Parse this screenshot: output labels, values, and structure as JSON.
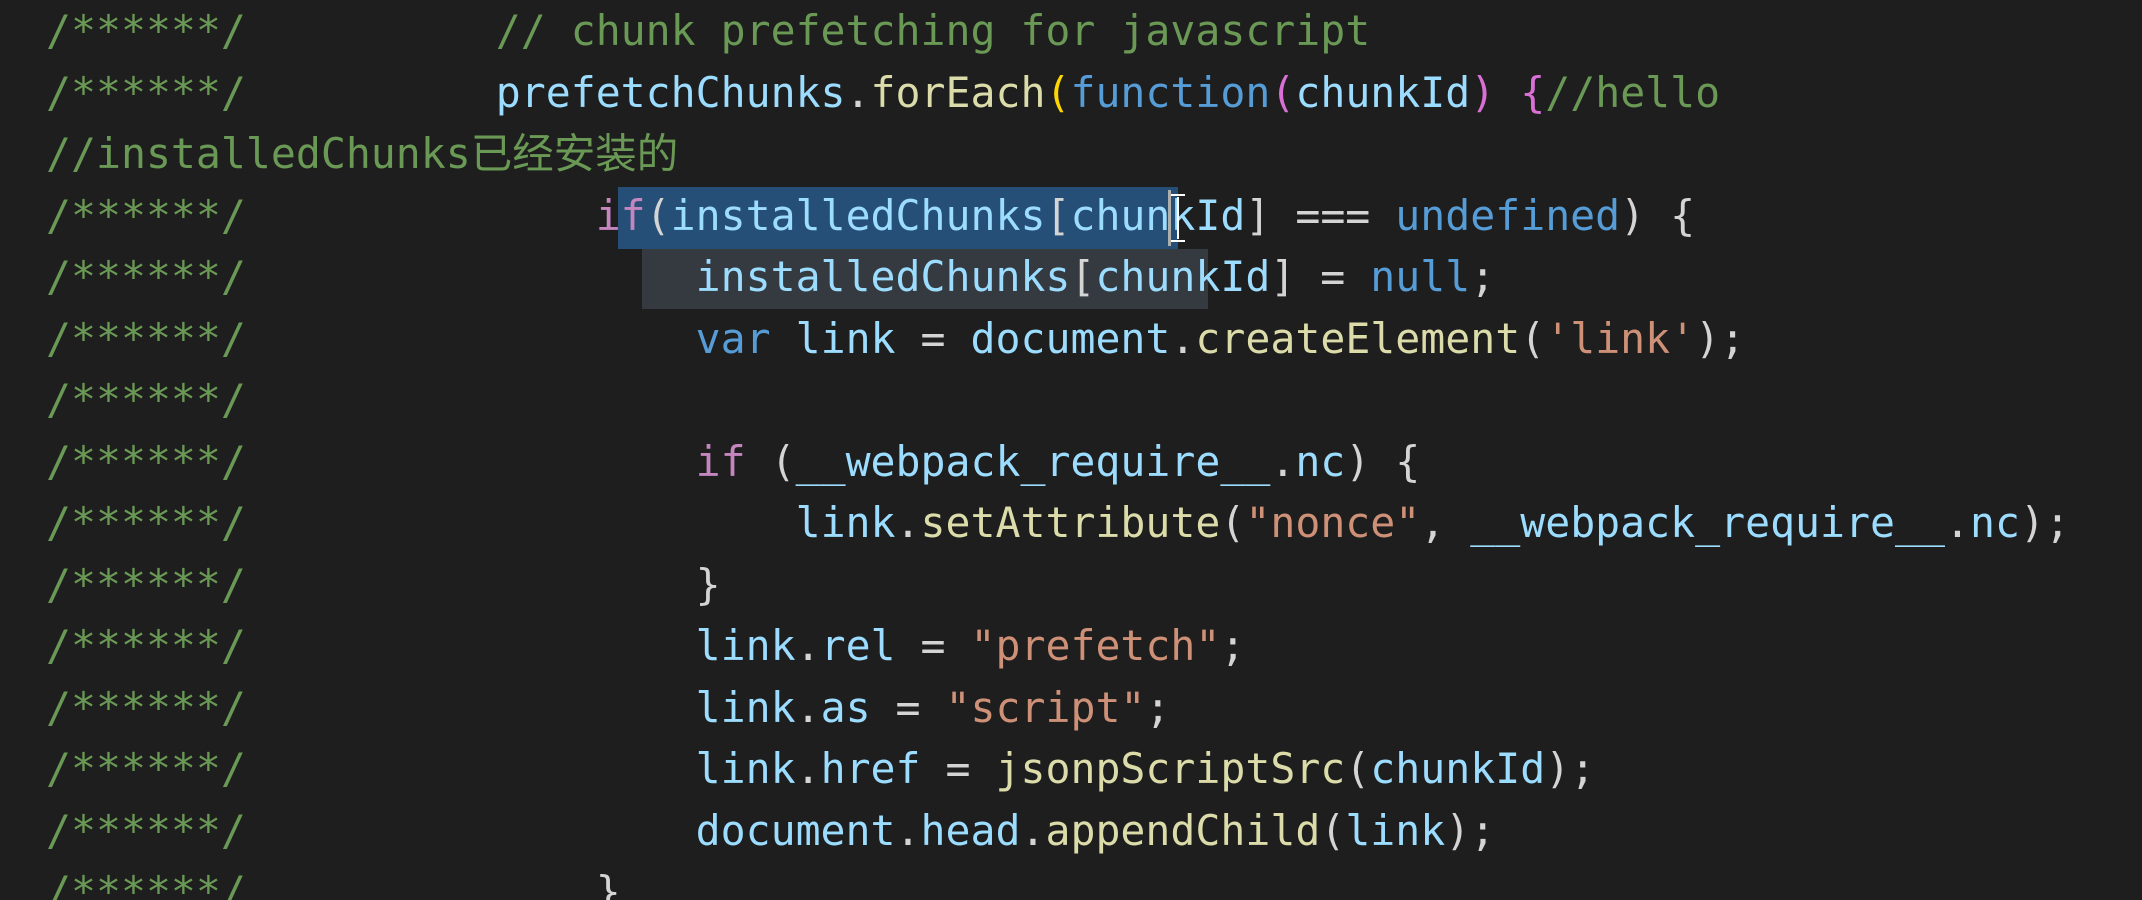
{
  "editor": {
    "lines": [
      {
        "indent": 0,
        "tokens": [
          {
            "text": "/******/",
            "role": "comment"
          },
          {
            "text": "          ",
            "role": "punc"
          },
          {
            "text": "// chunk prefetching for javascript",
            "role": "comment"
          }
        ]
      },
      {
        "indent": 0,
        "tokens": [
          {
            "text": "/******/",
            "role": "comment"
          },
          {
            "text": "          ",
            "role": "punc"
          },
          {
            "text": "prefetchChunks",
            "role": "var"
          },
          {
            "text": ".",
            "role": "punc"
          },
          {
            "text": "forEach",
            "role": "func"
          },
          {
            "text": "(",
            "role": "gold"
          },
          {
            "text": "function",
            "role": "kw"
          },
          {
            "text": "(",
            "role": "pink"
          },
          {
            "text": "chunkId",
            "role": "var"
          },
          {
            "text": ") ",
            "role": "pink"
          },
          {
            "text": "{",
            "role": "pink"
          },
          {
            "text": "//hello",
            "role": "comment"
          }
        ]
      },
      {
        "indent": 0,
        "tokens": [
          {
            "text": "//installedChunks已经安装的",
            "role": "comment"
          }
        ]
      },
      {
        "indent": 0,
        "tokens": [
          {
            "text": "/******/",
            "role": "comment"
          },
          {
            "text": "              ",
            "role": "punc"
          },
          {
            "text": "if",
            "role": "ctrl"
          },
          {
            "text": "(",
            "role": "punc"
          },
          {
            "text": "installedChunks",
            "role": "var"
          },
          {
            "text": "[",
            "role": "punc"
          },
          {
            "text": "chunkId",
            "role": "var"
          },
          {
            "text": "] === ",
            "role": "punc"
          },
          {
            "text": "undefined",
            "role": "kw"
          },
          {
            "text": ") {",
            "role": "punc"
          }
        ]
      },
      {
        "indent": 0,
        "tokens": [
          {
            "text": "/******/",
            "role": "comment"
          },
          {
            "text": "                  ",
            "role": "punc"
          },
          {
            "text": "installedChunks",
            "role": "var"
          },
          {
            "text": "[",
            "role": "punc"
          },
          {
            "text": "chunkId",
            "role": "var"
          },
          {
            "text": "] = ",
            "role": "punc"
          },
          {
            "text": "null",
            "role": "kw"
          },
          {
            "text": ";",
            "role": "punc"
          }
        ]
      },
      {
        "indent": 0,
        "tokens": [
          {
            "text": "/******/",
            "role": "comment"
          },
          {
            "text": "                  ",
            "role": "punc"
          },
          {
            "text": "var",
            "role": "kw"
          },
          {
            "text": " ",
            "role": "punc"
          },
          {
            "text": "link",
            "role": "var"
          },
          {
            "text": " = ",
            "role": "punc"
          },
          {
            "text": "document",
            "role": "var"
          },
          {
            "text": ".",
            "role": "punc"
          },
          {
            "text": "createElement",
            "role": "func"
          },
          {
            "text": "(",
            "role": "punc"
          },
          {
            "text": "'link'",
            "role": "str"
          },
          {
            "text": ");",
            "role": "punc"
          }
        ]
      },
      {
        "indent": 0,
        "tokens": [
          {
            "text": "/******/",
            "role": "comment"
          }
        ]
      },
      {
        "indent": 0,
        "tokens": [
          {
            "text": "/******/",
            "role": "comment"
          },
          {
            "text": "                  ",
            "role": "punc"
          },
          {
            "text": "if",
            "role": "ctrl"
          },
          {
            "text": " (",
            "role": "punc"
          },
          {
            "text": "__webpack_require__",
            "role": "var"
          },
          {
            "text": ".",
            "role": "punc"
          },
          {
            "text": "nc",
            "role": "var"
          },
          {
            "text": ") {",
            "role": "punc"
          }
        ]
      },
      {
        "indent": 0,
        "tokens": [
          {
            "text": "/******/",
            "role": "comment"
          },
          {
            "text": "                      ",
            "role": "punc"
          },
          {
            "text": "link",
            "role": "var"
          },
          {
            "text": ".",
            "role": "punc"
          },
          {
            "text": "setAttribute",
            "role": "func"
          },
          {
            "text": "(",
            "role": "punc"
          },
          {
            "text": "\"nonce\"",
            "role": "str"
          },
          {
            "text": ", ",
            "role": "punc"
          },
          {
            "text": "__webpack_require__",
            "role": "var"
          },
          {
            "text": ".",
            "role": "punc"
          },
          {
            "text": "nc",
            "role": "var"
          },
          {
            "text": ");",
            "role": "punc"
          }
        ]
      },
      {
        "indent": 0,
        "tokens": [
          {
            "text": "/******/",
            "role": "comment"
          },
          {
            "text": "                  ",
            "role": "punc"
          },
          {
            "text": "}",
            "role": "punc"
          }
        ]
      },
      {
        "indent": 0,
        "tokens": [
          {
            "text": "/******/",
            "role": "comment"
          },
          {
            "text": "                  ",
            "role": "punc"
          },
          {
            "text": "link",
            "role": "var"
          },
          {
            "text": ".",
            "role": "punc"
          },
          {
            "text": "rel",
            "role": "var"
          },
          {
            "text": " = ",
            "role": "punc"
          },
          {
            "text": "\"prefetch\"",
            "role": "str"
          },
          {
            "text": ";",
            "role": "punc"
          }
        ]
      },
      {
        "indent": 0,
        "tokens": [
          {
            "text": "/******/",
            "role": "comment"
          },
          {
            "text": "                  ",
            "role": "punc"
          },
          {
            "text": "link",
            "role": "var"
          },
          {
            "text": ".",
            "role": "punc"
          },
          {
            "text": "as",
            "role": "var"
          },
          {
            "text": " = ",
            "role": "punc"
          },
          {
            "text": "\"script\"",
            "role": "str"
          },
          {
            "text": ";",
            "role": "punc"
          }
        ]
      },
      {
        "indent": 0,
        "tokens": [
          {
            "text": "/******/",
            "role": "comment"
          },
          {
            "text": "                  ",
            "role": "punc"
          },
          {
            "text": "link",
            "role": "var"
          },
          {
            "text": ".",
            "role": "punc"
          },
          {
            "text": "href",
            "role": "var"
          },
          {
            "text": " = ",
            "role": "punc"
          },
          {
            "text": "jsonpScriptSrc",
            "role": "func"
          },
          {
            "text": "(",
            "role": "punc"
          },
          {
            "text": "chunkId",
            "role": "var"
          },
          {
            "text": ");",
            "role": "punc"
          }
        ]
      },
      {
        "indent": 0,
        "tokens": [
          {
            "text": "/******/",
            "role": "comment"
          },
          {
            "text": "                  ",
            "role": "punc"
          },
          {
            "text": "document",
            "role": "var"
          },
          {
            "text": ".",
            "role": "punc"
          },
          {
            "text": "head",
            "role": "var"
          },
          {
            "text": ".",
            "role": "punc"
          },
          {
            "text": "appendChild",
            "role": "func"
          },
          {
            "text": "(",
            "role": "punc"
          },
          {
            "text": "link",
            "role": "var"
          },
          {
            "text": ");",
            "role": "punc"
          }
        ]
      },
      {
        "indent": 0,
        "tokens": [
          {
            "text": "/******/",
            "role": "comment"
          },
          {
            "text": "              ",
            "role": "punc"
          },
          {
            "text": "}",
            "role": "punc"
          }
        ]
      }
    ]
  },
  "colors": {
    "background": "#1e1e1e",
    "comment": "#6a9955",
    "keyword": "#569cd6",
    "control": "#c586c0",
    "variable": "#9cdcfe",
    "function": "#dcdcaa",
    "string": "#ce9178",
    "selection": "#264f78"
  }
}
